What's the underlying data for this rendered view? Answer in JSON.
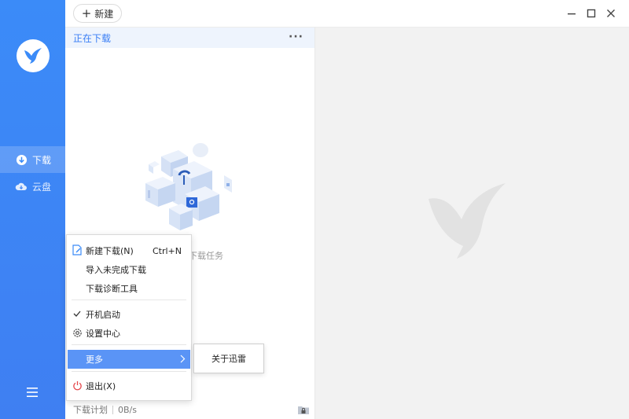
{
  "sidebar": {
    "nav": [
      {
        "label": "下载",
        "icon": "download-icon",
        "active": true
      },
      {
        "label": "云盘",
        "icon": "cloud-icon",
        "active": false
      }
    ]
  },
  "topbar": {
    "new_label": "新建"
  },
  "downloads": {
    "section_title": "正在下载",
    "more_label": "···",
    "empty_text": "下载任务"
  },
  "status_bar": {
    "plan_label": "下载计划",
    "speed": "0B/s"
  },
  "context_menu": {
    "items": [
      {
        "label": "新建下载(N)",
        "shortcut": "Ctrl+N",
        "icon": "new-download-icon"
      },
      {
        "label": "导入未完成下载"
      },
      {
        "label": "下载诊断工具"
      },
      {
        "label": "开机启动",
        "checked": true
      },
      {
        "label": "设置中心",
        "icon": "gear-icon"
      },
      {
        "label": "更多",
        "highlighted": true,
        "has_submenu": true
      },
      {
        "label": "退出(X)",
        "icon": "power-icon"
      }
    ],
    "submenu": {
      "label": "关于迅雷"
    }
  },
  "colors": {
    "sidebar": "#3b8bf8",
    "accent": "#3a7ef5",
    "menu_highlight": "#5a94f6",
    "exit_icon": "#e5484d"
  }
}
